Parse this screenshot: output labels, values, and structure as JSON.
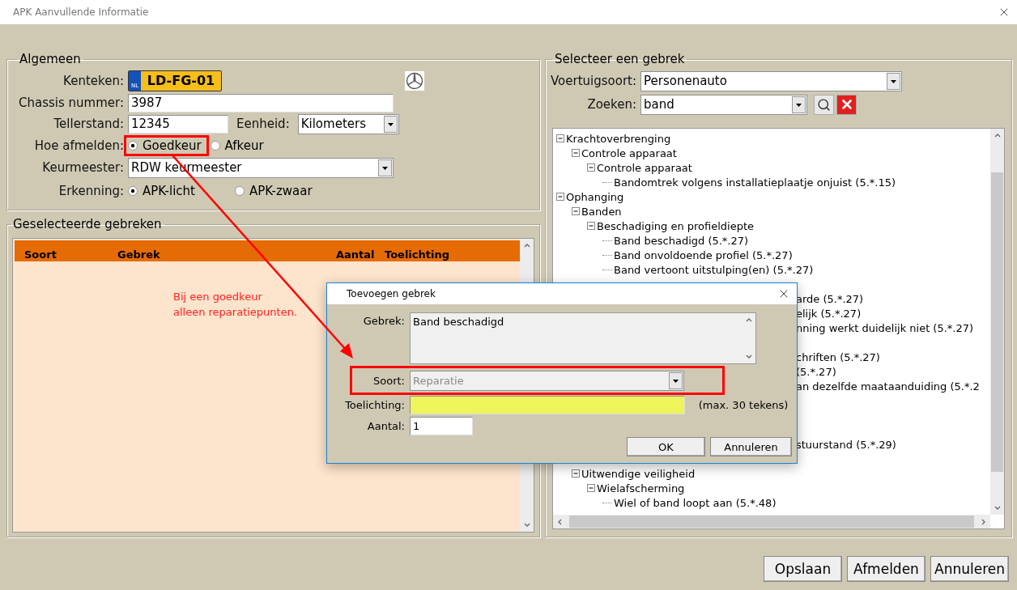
{
  "window": {
    "title": "APK Aanvullende Informatie"
  },
  "general": {
    "title": "Algemeen",
    "plate": {
      "label": "Kenteken:",
      "country": "NL",
      "number": "LD-FG-01"
    },
    "chassis": {
      "label": "Chassis nummer:",
      "value": "3987"
    },
    "odometer": {
      "label": "Tellerstand:",
      "value": "12345"
    },
    "unit": {
      "label": "Eenheid:",
      "value": "Kilometers"
    },
    "result": {
      "label": "Hoe afmelden:",
      "options": [
        {
          "label": "Goedkeur",
          "selected": true,
          "highlighted": true
        },
        {
          "label": "Afkeur",
          "selected": false,
          "highlighted": false
        }
      ]
    },
    "inspector": {
      "label": "Keurmeester:",
      "value": "RDW keurmeester"
    },
    "recognition": {
      "label": "Erkenning:",
      "options": [
        {
          "label": "APK-licht",
          "selected": true
        },
        {
          "label": "APK-zwaar",
          "selected": false
        }
      ]
    }
  },
  "selected_defects": {
    "title": "Geselecteerde gebreken",
    "columns": [
      "Soort",
      "Gebrek",
      "Aantal",
      "Toelichting"
    ],
    "note": "Bij een goedkeur\nalleen reparatiepunten."
  },
  "picker": {
    "title": "Selecteer een gebrek",
    "vehicle_type": {
      "label": "Voertuigsoort:",
      "value": "Personenauto"
    },
    "search": {
      "label": "Zoeken:",
      "value": "band"
    },
    "tree": [
      {
        "label": "Krachtoverbrenging",
        "expanded": true,
        "children": [
          {
            "label": "Controle apparaat",
            "expanded": true,
            "children": [
              {
                "label": "Controle apparaat",
                "expanded": true,
                "children": [
                  {
                    "label": "Bandomtrek volgens installatieplaatje onjuist (5.*.15)"
                  }
                ]
              }
            ]
          }
        ]
      },
      {
        "label": "Ophanging",
        "expanded": true,
        "children": [
          {
            "label": "Banden",
            "expanded": true,
            "children": [
              {
                "label": "Beschadiging en profieldiepte",
                "expanded": true,
                "children": [
                  {
                    "label": "Band beschadigd (5.*.27)"
                  },
                  {
                    "label": "Band onvoldoende profiel (5.*.27)"
                  },
                  {
                    "label": "Band vertoont uitstulping(en) (5.*.27)"
                  }
                ]
              }
            ]
          },
          {
            "kind": "covered"
          },
          {
            "kind": "covered",
            "label": "arde (5.*.27)"
          },
          {
            "kind": "covered",
            "label": "elijk (5.*.27)"
          },
          {
            "kind": "covered",
            "label": "nning werkt duidelijk niet (5.*.27)"
          },
          {
            "kind": "covered"
          },
          {
            "kind": "covered",
            "label": "chriften (5.*.27)"
          },
          {
            "kind": "covered",
            "label": "(5.*.27)"
          },
          {
            "kind": "covered",
            "label": "an dezelfde maataanduiding (5.*.2"
          },
          {
            "kind": "covered"
          },
          {
            "kind": "covered"
          },
          {
            "kind": "covered"
          },
          {
            "kind": "covered",
            "label": "stuurstand (5.*.29)"
          },
          {
            "kind": "covered"
          },
          {
            "label": "Uitwendige veiligheid",
            "expanded": true,
            "children": [
              {
                "label": "Wielafscherming",
                "expanded": true,
                "children": [
                  {
                    "label": "Wiel of band loopt aan (5.*.48)"
                  }
                ]
              }
            ]
          }
        ]
      }
    ]
  },
  "dialog": {
    "title": "Toevoegen gebrek",
    "defect": {
      "label": "Gebrek:",
      "value": "Band beschadigd"
    },
    "type": {
      "label": "Soort:",
      "value": "Reparatie",
      "disabled": true,
      "highlighted": true
    },
    "comment": {
      "label": "Toelichting:",
      "hint": "(max. 30 tekens)"
    },
    "quantity": {
      "label": "Aantal:",
      "value": "1"
    },
    "buttons": [
      "OK",
      "Annuleren"
    ]
  },
  "buttons": [
    "Opslaan",
    "Afmelden",
    "Annuleren"
  ]
}
